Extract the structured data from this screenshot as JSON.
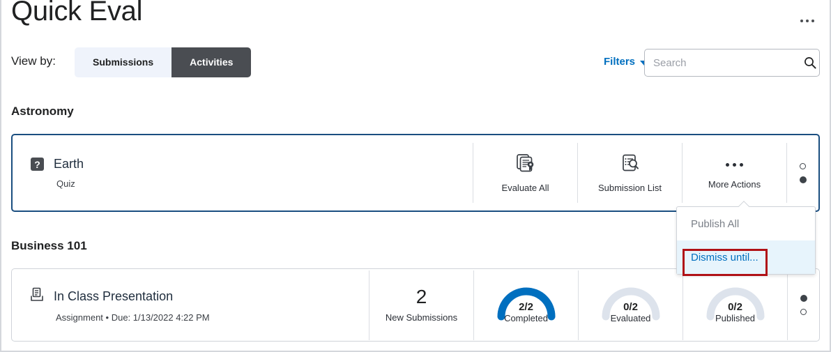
{
  "header": {
    "title": "Quick Eval",
    "overflow_icon": "ellipsis-icon"
  },
  "controls": {
    "view_by_label": "View by:",
    "toggle": {
      "options": [
        "Submissions",
        "Activities"
      ],
      "selected": "Activities"
    },
    "filters_label": "Filters",
    "search": {
      "placeholder": "Search",
      "value": ""
    }
  },
  "sections": [
    {
      "name": "Astronomy",
      "item": {
        "title": "Earth",
        "subtitle": "Quiz",
        "type_icon": "quiz-icon",
        "type_glyph": "?",
        "actions": [
          {
            "label": "Evaluate All",
            "icon": "documents-award-icon"
          },
          {
            "label": "Submission List",
            "icon": "document-search-icon"
          },
          {
            "label": "More Actions",
            "icon": "ellipsis-icon"
          }
        ]
      }
    },
    {
      "name": "Business 101",
      "item": {
        "title": "In Class Presentation",
        "subtitle": "Assignment • Due: 1/13/2022 4:22 PM",
        "type_icon": "assignment-inbox-icon",
        "stats": [
          {
            "kind": "number",
            "value": "2",
            "caption": "New Submissions"
          },
          {
            "kind": "gauge",
            "value": "2/2",
            "caption": "Completed",
            "pct": 100
          },
          {
            "kind": "gauge",
            "value": "0/2",
            "caption": "Evaluated",
            "pct": 0
          },
          {
            "kind": "gauge",
            "value": "0/2",
            "caption": "Published",
            "pct": 0
          }
        ]
      }
    }
  ],
  "dropdown": {
    "items": [
      {
        "label": "Publish All",
        "state": "disabled"
      },
      {
        "label": "Dismiss until...",
        "state": "highlight"
      }
    ]
  },
  "colors": {
    "accent_blue": "#006fbf",
    "gauge_filled": "#006fbf",
    "gauge_empty": "#dde3ec",
    "toggle_active_bg": "#4a4d52",
    "toggle_inactive_bg": "#eff3fb",
    "annotation_red": "#b01116",
    "focus_border": "#1a4e80"
  }
}
